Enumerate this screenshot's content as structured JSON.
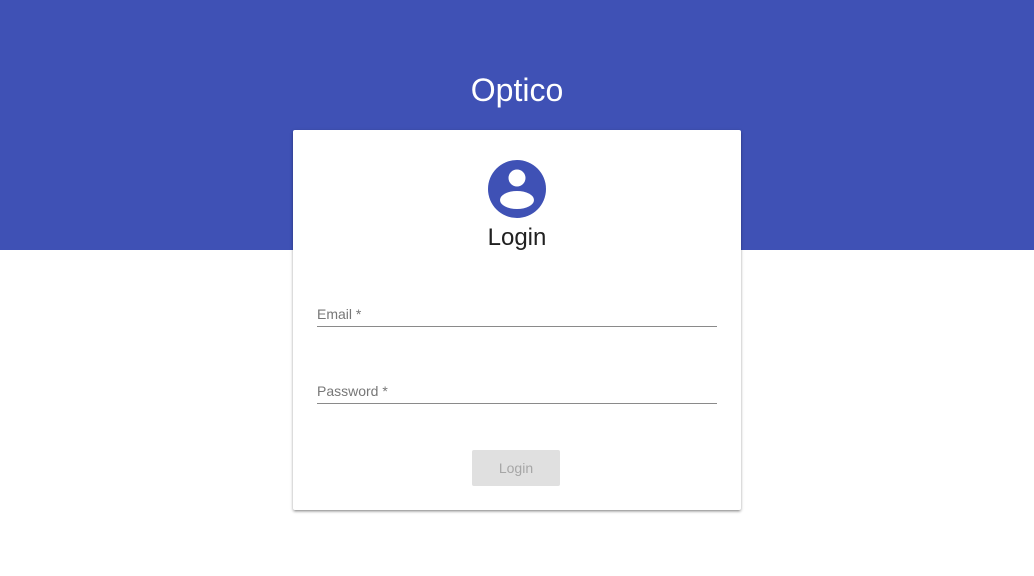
{
  "app": {
    "title": "Optico",
    "brand_color": "#3f51b5"
  },
  "login_card": {
    "avatar_icon": "account-circle-icon",
    "title": "Login",
    "email": {
      "label": "Email *",
      "value": ""
    },
    "password": {
      "label": "Password *",
      "value": ""
    },
    "submit_label": "Login",
    "submit_disabled": true
  }
}
